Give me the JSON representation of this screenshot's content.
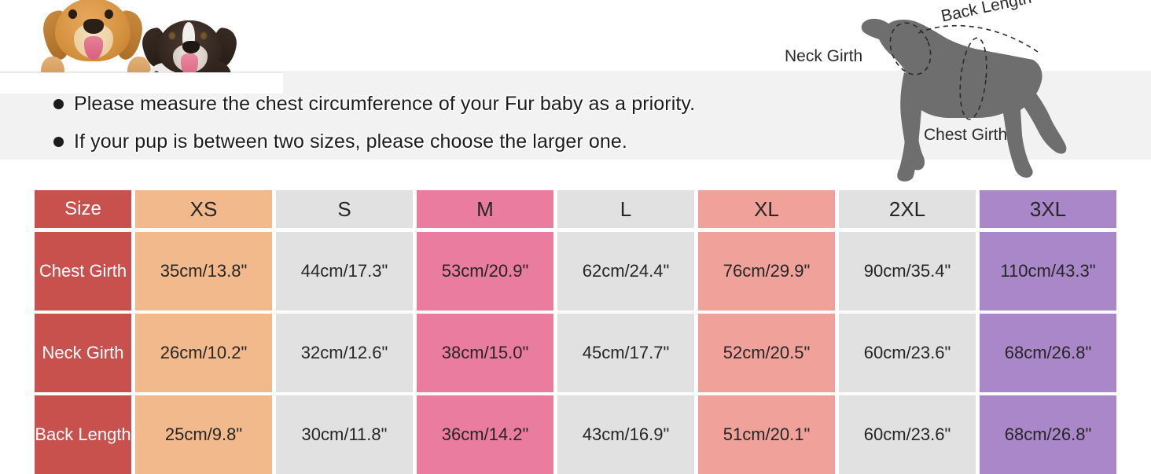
{
  "notes": [
    "Please measure the chest circumference of your Fur baby as a priority.",
    "If your pup is between two sizes, please choose the larger one."
  ],
  "diagram": {
    "neck_girth_label": "Neck Girth",
    "chest_girth_label": "Chest Girth",
    "back_length_label": "Back Length"
  },
  "table": {
    "corner_label": "Size",
    "sizes": [
      "XS",
      "S",
      "M",
      "L",
      "XL",
      "2XL",
      "3XL"
    ],
    "row_labels": [
      "Chest Girth",
      "Neck Girth",
      "Back Length"
    ],
    "rows": [
      {
        "label": "Chest Girth",
        "values": [
          "35cm/13.8\"",
          "44cm/17.3\"",
          "53cm/20.9\"",
          "62cm/24.4\"",
          "76cm/29.9\"",
          "90cm/35.4\"",
          "110cm/43.3\""
        ]
      },
      {
        "label": "Neck Girth",
        "values": [
          "26cm/10.2\"",
          "32cm/12.6\"",
          "38cm/15.0\"",
          "45cm/17.7\"",
          "52cm/20.5\"",
          "60cm/23.6\"",
          "68cm/26.8\""
        ]
      },
      {
        "label": "Back Length",
        "values": [
          "25cm/9.8\"",
          "30cm/11.8\"",
          "36cm/14.2\"",
          "43cm/16.9\"",
          "51cm/20.1\"",
          "60cm/23.6\"",
          "68cm/26.8\""
        ]
      }
    ],
    "column_colors": [
      "#f2b98d",
      "#e1e1e1",
      "#ea7ca0",
      "#e1e1e1",
      "#f0a19a",
      "#e1e1e1",
      "#a987c8"
    ],
    "label_color": "#c8514e",
    "gap_color": "#ffffff"
  },
  "colors": {
    "band_background": "#f2f2f2",
    "page_background": "#ffffff",
    "text": "#262626",
    "diagram_body": "#6e6e6e"
  }
}
